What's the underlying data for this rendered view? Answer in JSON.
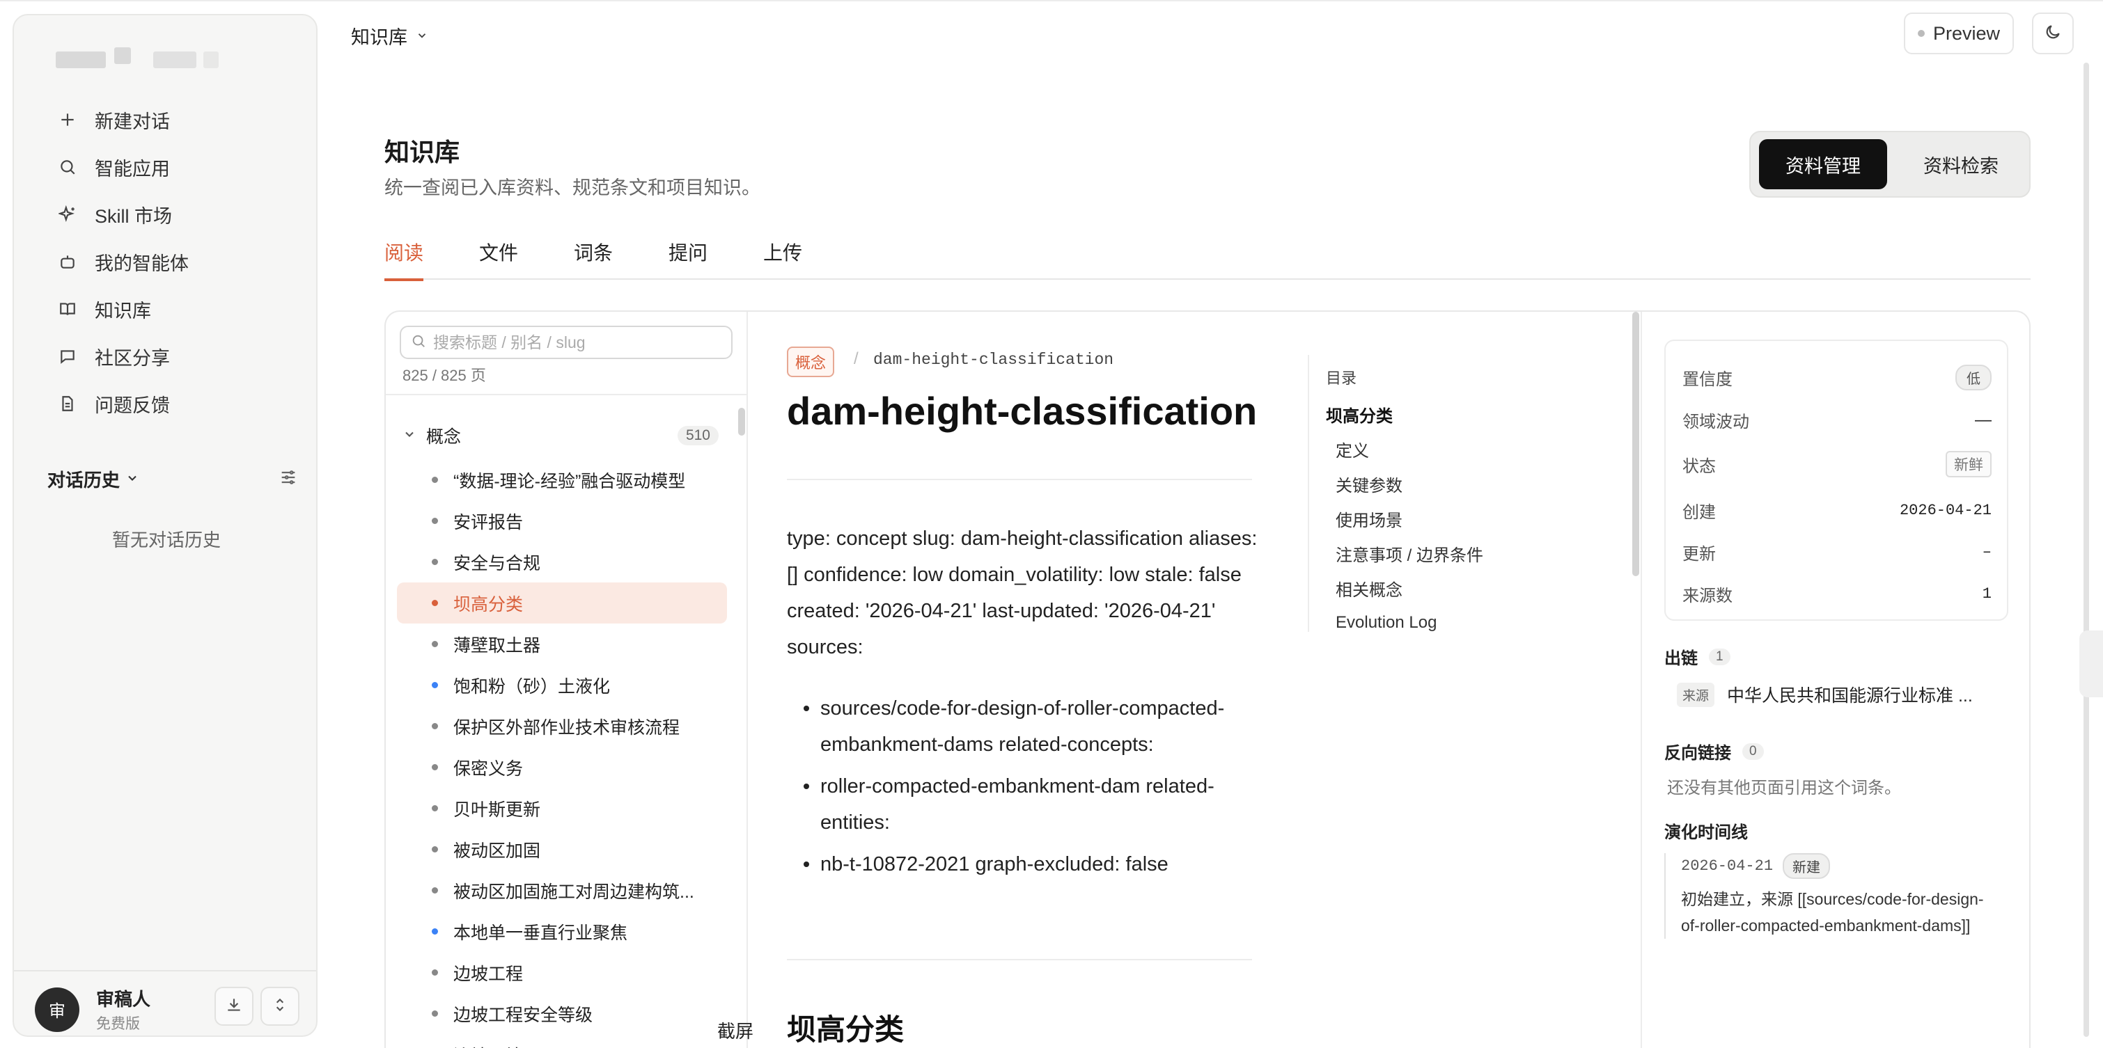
{
  "sidebar": {
    "nav": [
      {
        "label": "新建对话",
        "icon": "plus-icon"
      },
      {
        "label": "智能应用",
        "icon": "search-icon"
      },
      {
        "label": "Skill 市场",
        "icon": "sparkle-icon"
      },
      {
        "label": "我的智能体",
        "icon": "bot-icon"
      },
      {
        "label": "知识库",
        "icon": "book-icon"
      },
      {
        "label": "社区分享",
        "icon": "chat-icon"
      },
      {
        "label": "问题反馈",
        "icon": "document-icon"
      }
    ],
    "history_title": "对话历史",
    "history_empty": "暂无对话历史",
    "user": {
      "avatar_letter": "审",
      "name": "审稿人",
      "plan": "免费版"
    }
  },
  "topbar": {
    "breadcrumb": "知识库",
    "preview_label": "Preview"
  },
  "header": {
    "title": "知识库",
    "subtitle": "统一查阅已入库资料、规范条文和项目知识。",
    "segments": [
      "资料管理",
      "资料检索"
    ]
  },
  "tabs": [
    "阅读",
    "文件",
    "词条",
    "提问",
    "上传"
  ],
  "list": {
    "search_placeholder": "搜索标题 / 别名 / slug",
    "count": "825 / 825 页",
    "group_label": "概念",
    "group_count": "510",
    "items": [
      "“数据-理论-经验”融合驱动模型",
      "安评报告",
      "安全与合规",
      "坝高分类",
      "薄壁取土器",
      "饱和粉（砂）土液化",
      "保护区外部作业技术审核流程",
      "保密义务",
      "贝叶斯更新",
      "被动区加固",
      "被动区加固施工对周边建构筑...",
      "本地单一垂直行业聚焦",
      "边坡工程",
      "边坡工程安全等级",
      "边坡环境"
    ]
  },
  "article": {
    "tag": "概念",
    "slug": "dam-height-classification",
    "title": "dam-height-classification",
    "body": "type: concept slug: dam-height-classification aliases: [] confidence: low domain_volatility: low stale: false created: '2026-04-21' last-updated: '2026-04-21' sources:",
    "bullets": [
      "sources/code-for-design-of-roller-compacted-embankment-dams related-concepts:",
      "roller-compacted-embankment-dam related-entities:",
      "nb-t-10872-2021 graph-excluded: false"
    ],
    "section_heading": "坝高分类",
    "toc_title": "目录",
    "toc": [
      "坝高分类",
      "定义",
      "关键参数",
      "使用场景",
      "注意事项 / 边界条件",
      "相关概念",
      "Evolution Log"
    ]
  },
  "clip_label": "截屏",
  "meta": {
    "confidence_label": "置信度",
    "confidence_value": "低",
    "volatility_label": "领域波动",
    "volatility_value": "—",
    "status_label": "状态",
    "status_value": "新鲜",
    "created_label": "创建",
    "created_value": "2026-04-21",
    "updated_label": "更新",
    "updated_value": "–",
    "sources_label": "来源数",
    "sources_value": "1",
    "outlinks_title": "出链",
    "outlinks_count": "1",
    "outlink_tag": "来源",
    "outlink_text": "中华人民共和国能源行业标准 ...",
    "backlinks_title": "反向链接",
    "backlinks_count": "0",
    "backlinks_empty": "还没有其他页面引用这个词条。",
    "timeline_title": "演化时间线",
    "timeline_date": "2026-04-21",
    "timeline_badge": "新建",
    "timeline_text": "初始建立，来源 [[sources/code-for-design-of-roller-compacted-embankment-dams]]"
  },
  "colors": {
    "accent": "#d9603b",
    "dark": "#111111",
    "active_bg": "#fbe9e2",
    "blue_dot": "#3b82f6"
  }
}
